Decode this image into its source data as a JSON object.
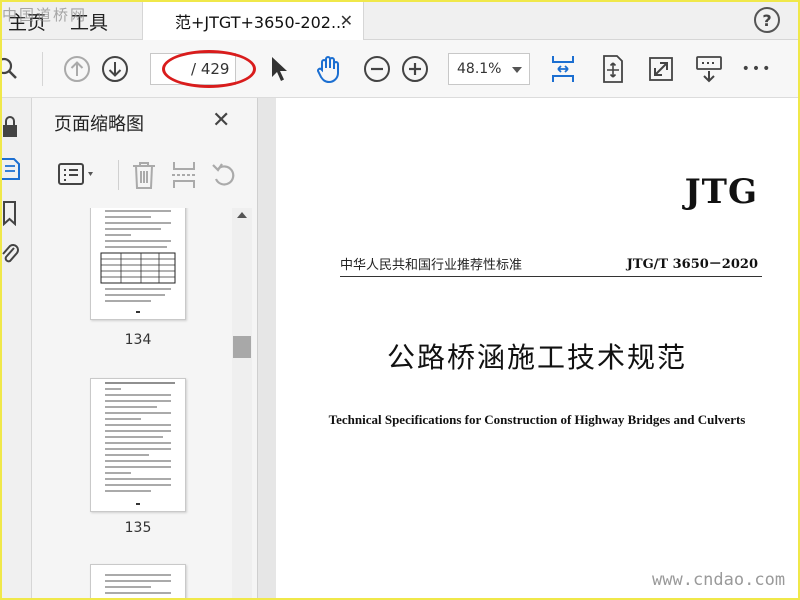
{
  "watermark_top": "中国道桥网",
  "tabs": {
    "home": "主页",
    "tools": "工具",
    "document": "范+JTGT+3650-202...",
    "close_symbol": "✕",
    "help_symbol": "?"
  },
  "toolbar": {
    "page_total": "/ 429",
    "zoom": "48.1%",
    "more": "•••"
  },
  "thumbnails": {
    "title": "页面缩略图",
    "close_symbol": "✕",
    "pages": [
      "134",
      "135"
    ]
  },
  "document": {
    "logo": "JTG",
    "standard_category": "中华人民共和国行业推荐性标准",
    "standard_code": "JTG/T  3650－2020",
    "title_cn": "公路桥涵施工技术规范",
    "title_en": "Technical Specifications for Construction of Highway Bridges and Culverts"
  },
  "watermark_bottom": "www.cndao.com",
  "colors": {
    "accent_blue": "#1c6fd1",
    "annotation_red": "#d91c1c",
    "frame_yellow": "#f0e84a"
  }
}
